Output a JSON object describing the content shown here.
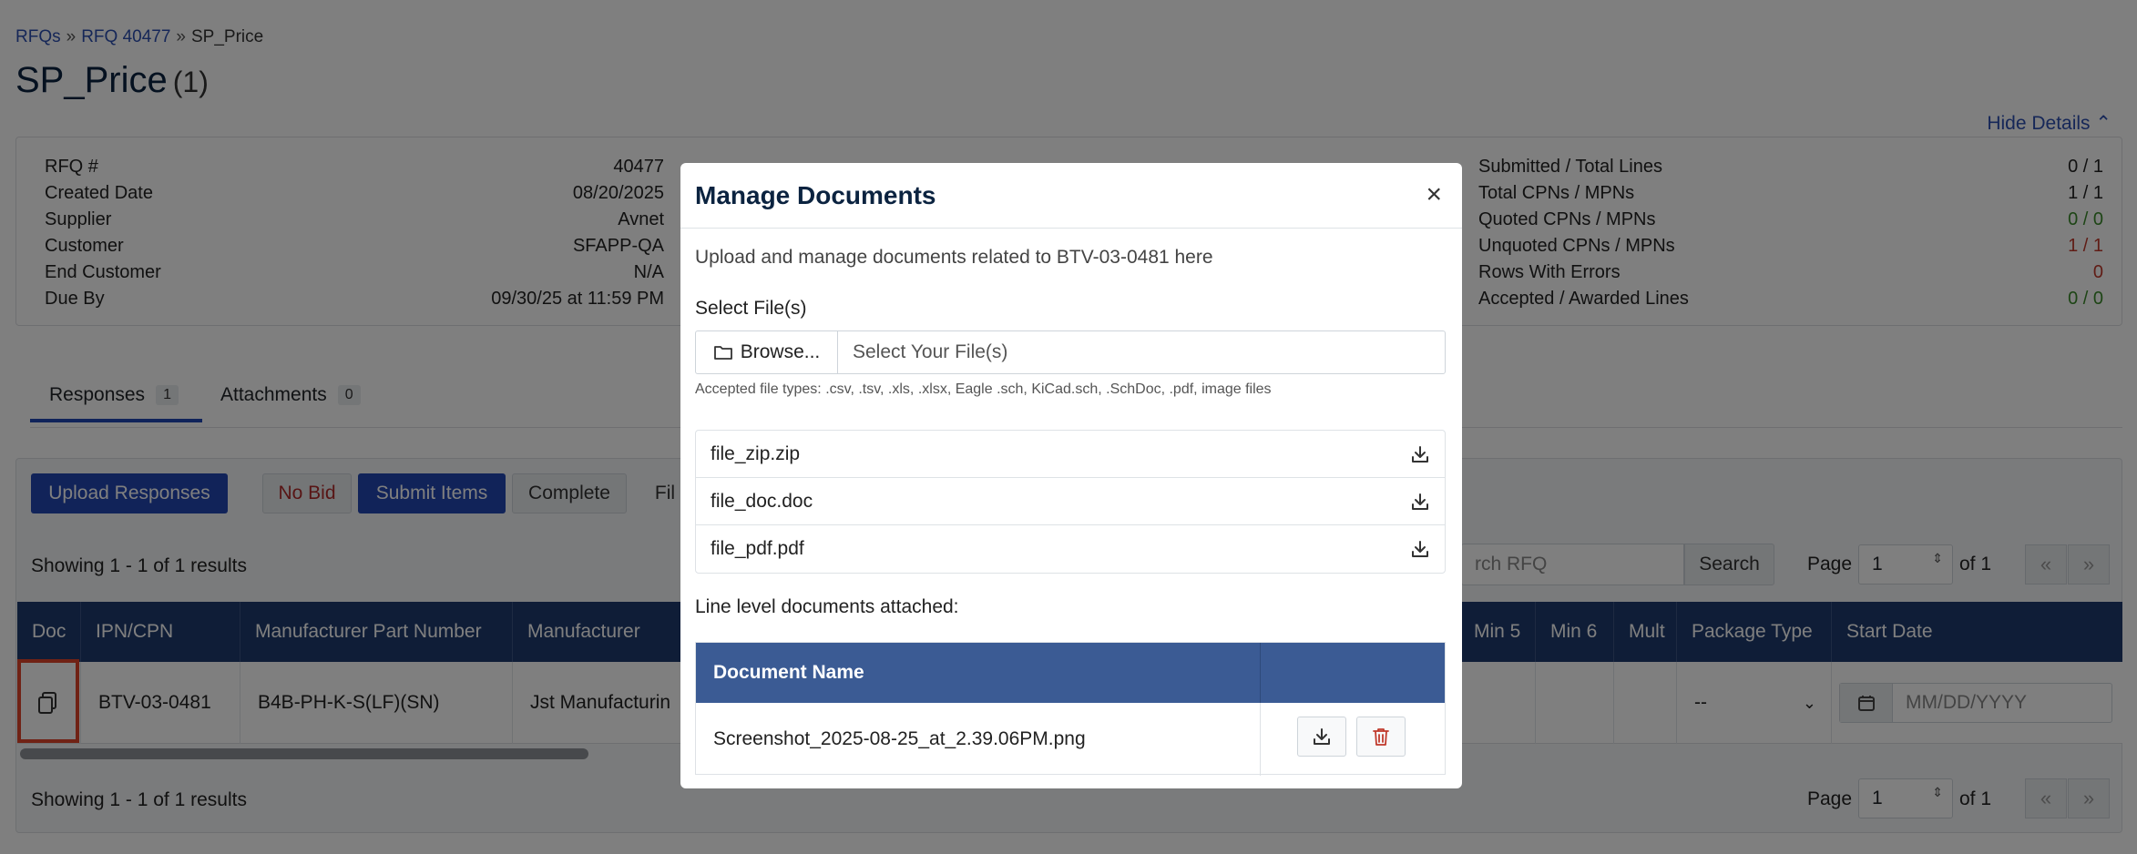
{
  "breadcrumb": {
    "rfqs": "RFQs",
    "sep1": "»",
    "rfq": "RFQ 40477",
    "sep2": "»",
    "current": "SP_Price"
  },
  "page": {
    "title": "SP_Price",
    "count": "(1)",
    "hide_details": "Hide Details"
  },
  "details": {
    "col1": [
      {
        "label": "RFQ #",
        "value": "40477"
      },
      {
        "label": "Created Date",
        "value": "08/20/2025"
      },
      {
        "label": "Supplier",
        "value": "Avnet"
      },
      {
        "label": "Customer",
        "value": "SFAPP-QA"
      },
      {
        "label": "End Customer",
        "value": "N/A"
      },
      {
        "label": "Due By",
        "value": "09/30/25 at 11:59 PM"
      }
    ],
    "col3": [
      {
        "label": "Submitted / Total Lines",
        "value": "0 / 1"
      },
      {
        "label": "Total CPNs / MPNs",
        "value": "1 / 1"
      },
      {
        "label": "Quoted CPNs / MPNs",
        "value": "0 / 0"
      },
      {
        "label": "Unquoted CPNs / MPNs",
        "value": "1 / 1"
      },
      {
        "label": "Rows With Errors",
        "value": "0"
      },
      {
        "label": "Accepted / Awarded Lines",
        "value": "0 / 0"
      }
    ]
  },
  "tabs": [
    {
      "label": "Responses",
      "count": "1"
    },
    {
      "label": "Attachments",
      "count": "0"
    }
  ],
  "toolbar": {
    "upload": "Upload Responses",
    "no_bid": "No Bid",
    "submit": "Submit Items",
    "complete": "Complete",
    "filter_partial": "Fil"
  },
  "results": {
    "top": "Showing 1 - 1 of 1 results",
    "bottom": "Showing 1 - 1 of 1 results"
  },
  "search": {
    "placeholder": "rch RFQ",
    "button": "Search"
  },
  "pager": {
    "label": "Page",
    "value": "1",
    "of": "of 1",
    "first": "«",
    "last": "»"
  },
  "grid": {
    "headers": {
      "doc": "Doc",
      "ipn": "IPN/CPN",
      "mpn": "Manufacturer Part Number",
      "mfr": "Manufacturer",
      "min5": "Min 5",
      "min6": "Min 6",
      "mult": "Mult",
      "pkg": "Package Type",
      "start": "Start Date"
    },
    "row": {
      "ipn": "BTV-03-0481",
      "mpn": "B4B-PH-K-S(LF)(SN)",
      "mfr": "Jst Manufacturin",
      "pkg": "--",
      "start_placeholder": "MM/DD/YYYY"
    }
  },
  "modal": {
    "title": "Manage Documents",
    "close": "×",
    "intro": "Upload and manage documents related to BTV-03-0481 here",
    "select_label": "Select File(s)",
    "browse": "Browse...",
    "file_placeholder": "Select Your File(s)",
    "accepted": "Accepted file types: .csv, .tsv, .xls, .xlsx, Eagle .sch, KiCad.sch, .SchDoc, .pdf, image files",
    "files": [
      "file_zip.zip",
      "file_doc.doc",
      "file_pdf.pdf"
    ],
    "line_label": "Line level documents attached:",
    "table_header": "Document Name",
    "line_doc": "Screenshot_2025-08-25_at_2.39.06PM.png"
  },
  "colors": {
    "brand_blue": "#2346b3",
    "grid_header": "#1e3a6e",
    "doc_table_header": "#3b5b94",
    "highlight": "#e0442b",
    "delete": "#c0392b"
  }
}
